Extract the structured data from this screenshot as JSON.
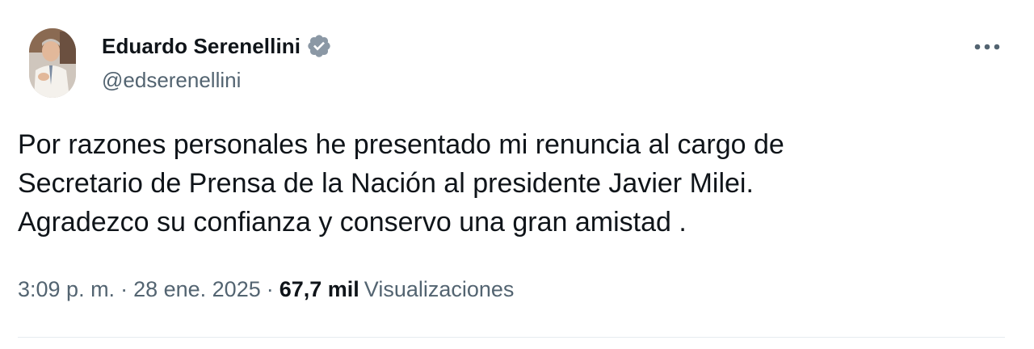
{
  "author": {
    "display_name": "Eduardo Serenellini",
    "handle": "@edserenellini",
    "verified": true,
    "avatar_icon": "profile-photo"
  },
  "tweet": {
    "lines": [
      "Por razones personales he presentado mi renuncia al cargo de",
      "Secretario de Prensa de la Nación al presidente Javier Milei.",
      "Agradezco su confianza y conservo una gran amistad ."
    ]
  },
  "meta": {
    "time": "3:09 p. m.",
    "separator": "·",
    "date": "28 ene. 2025",
    "views_count": "67,7 mil",
    "views_label": "Visualizaciones"
  },
  "colors": {
    "text": "#0f1419",
    "secondary": "#536471",
    "verified_badge": "#8b98a5",
    "divider": "#e6ecf0"
  },
  "icons": {
    "verified": "verified-badge-icon",
    "more": "more-options-icon"
  }
}
